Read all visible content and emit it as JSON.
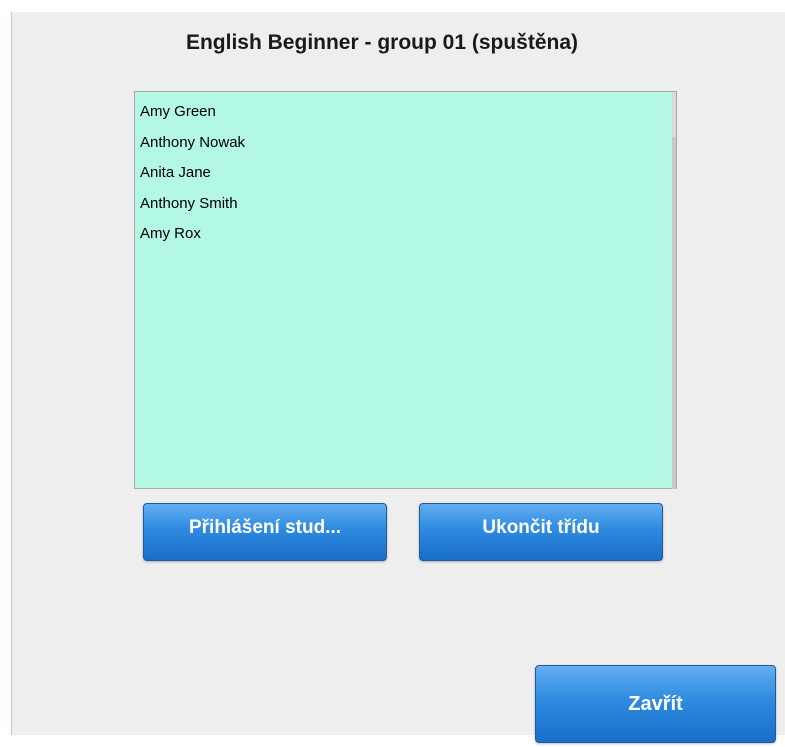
{
  "dialog": {
    "title": "English Beginner - group 01 (spuštěna)"
  },
  "students": {
    "items": [
      "Amy Green",
      "Anthony Nowak",
      "Anita Jane",
      "Anthony Smith",
      "Amy Rox"
    ]
  },
  "buttons": {
    "login_label": "Přihlášení stud...",
    "end_class_label": "Ukončit třídu",
    "close_label": "Zavřít"
  },
  "colors": {
    "list_background": "#b3f8e4",
    "button_blue": "#2e8ae0"
  }
}
